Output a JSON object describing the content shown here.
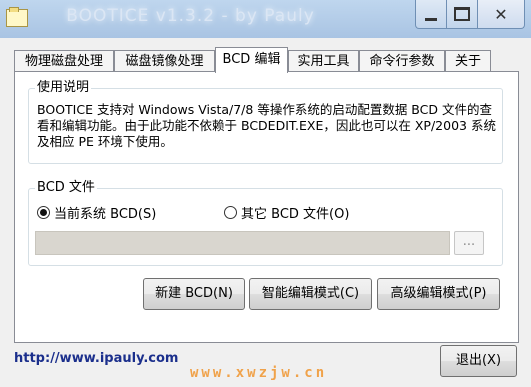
{
  "window": {
    "title": "BOOTICE v1.3.2 - by Pauly",
    "icon": "folder-icon",
    "controls": {
      "minimize": "minimize-icon",
      "maximize": "maximize-icon",
      "close": "close-icon",
      "close_glyph": "✕"
    }
  },
  "tabs": [
    {
      "label": "物理磁盘处理",
      "active": false
    },
    {
      "label": "磁盘镜像处理",
      "active": false
    },
    {
      "label": "BCD 编辑",
      "active": true
    },
    {
      "label": "实用工具",
      "active": false
    },
    {
      "label": "命令行参数",
      "active": false
    },
    {
      "label": "关于",
      "active": false
    }
  ],
  "usage": {
    "heading": "使用说明",
    "text": "BOOTICE 支持对 Windows Vista/7/8 等操作系统的启动配置数据 BCD 文件的查看和编辑功能。由于此功能不依赖于 BCDEDIT.EXE，因此也可以在 XP/2003 系统及相应 PE 环境下使用。"
  },
  "bcd_file": {
    "heading": "BCD 文件",
    "option_current": "当前系统 BCD(S)",
    "option_other": "其它 BCD 文件(O)",
    "selected": "current",
    "path_value": "",
    "browse_label": "..."
  },
  "actions": {
    "new_bcd": "新建 BCD(N)",
    "smart_edit": "智能编辑模式(C)",
    "advanced_edit": "高级编辑模式(P)"
  },
  "footer": {
    "link": "http://www.ipauly.com",
    "watermark": "www.xwzjw.cn",
    "exit": "退出(X)"
  },
  "colors": {
    "titlebar": "#a9c4e3",
    "link": "#1b2f8c",
    "watermark": "#f0a24a"
  }
}
